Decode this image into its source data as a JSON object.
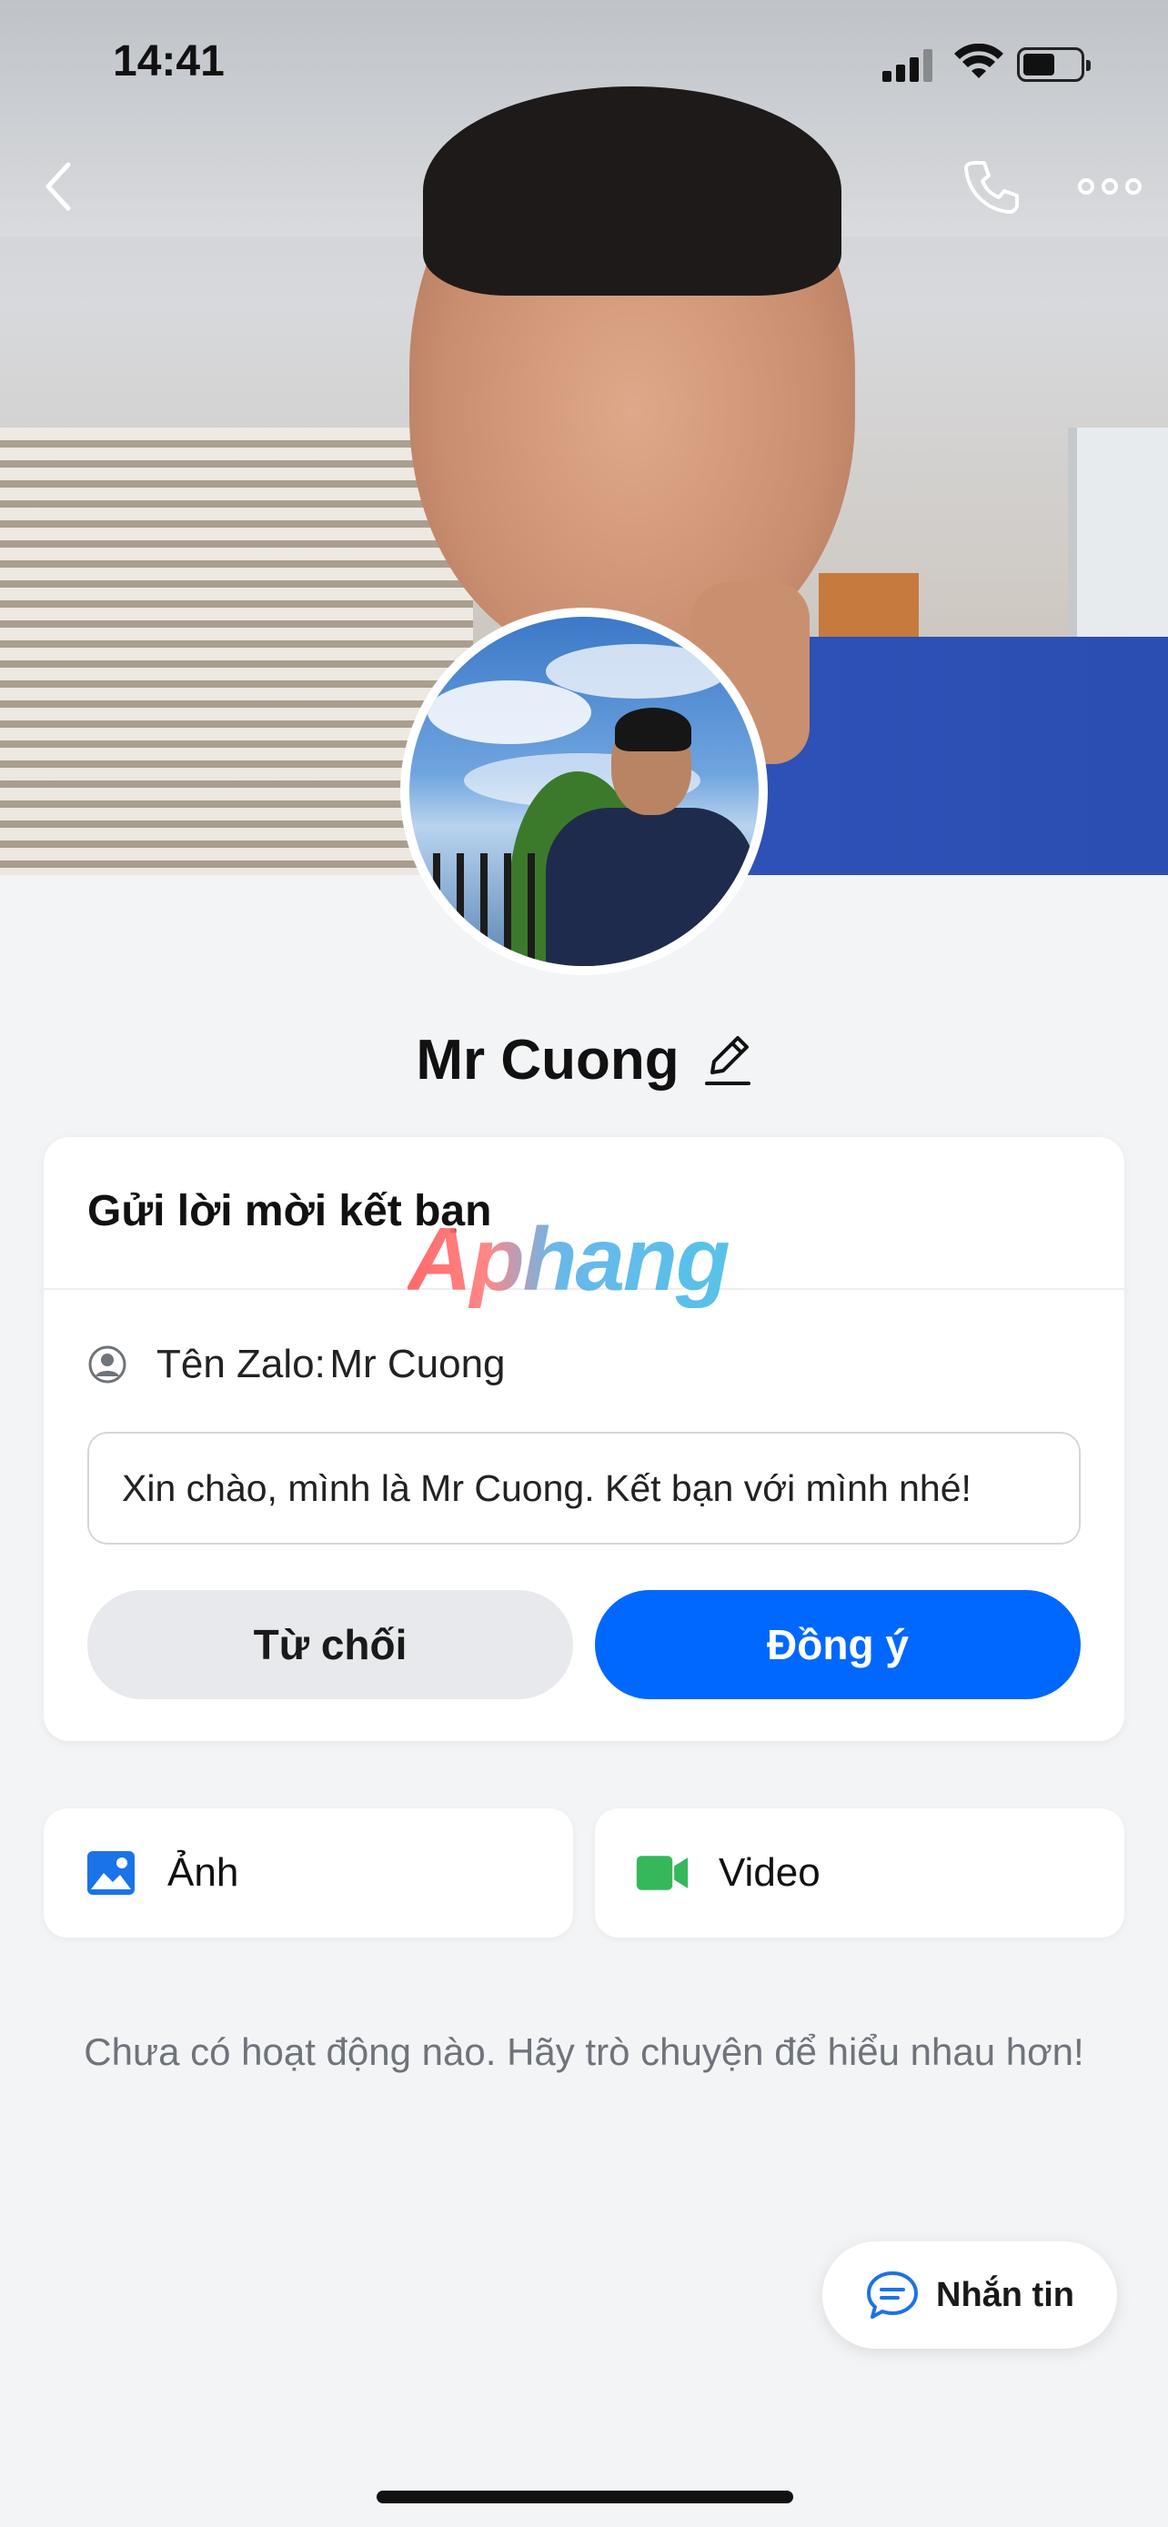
{
  "status_bar": {
    "time": "14:41",
    "icons": [
      "cellular-signal-icon",
      "wifi-icon",
      "battery-icon"
    ]
  },
  "top_nav": {
    "icons": [
      "chevron-left-icon",
      "phone-icon",
      "more-horizontal-icon"
    ]
  },
  "profile": {
    "name": "Mr Cuong",
    "edit_icon": "pencil-icon"
  },
  "friend_request": {
    "title": "Gửi lời mời kết bạn",
    "zalo_name_label": "Tên Zalo:",
    "zalo_name_value": "Mr Cuong",
    "zalo_icon": "user-circle-icon",
    "message": "Xin chào, mình là Mr Cuong. Kết bạn với mình nhé!",
    "decline_label": "Từ chối",
    "accept_label": "Đồng ý"
  },
  "watermark": {
    "text": "Aphang"
  },
  "media": {
    "photo_label": "Ảnh",
    "photo_icon": "image-icon",
    "video_label": "Video",
    "video_icon": "video-camera-icon"
  },
  "empty_state": {
    "text": "Chưa có hoạt động nào. Hãy trò chuyện để hiểu nhau hơn!"
  },
  "message_button": {
    "label": "Nhắn tin",
    "icon": "chat-bubble-icon"
  },
  "colors": {
    "accent": "#0068ff",
    "decline_bg": "#e7e9ec",
    "background": "#f3f4f6",
    "photo_icon": "#1a73e8",
    "video_icon": "#34b85a"
  }
}
